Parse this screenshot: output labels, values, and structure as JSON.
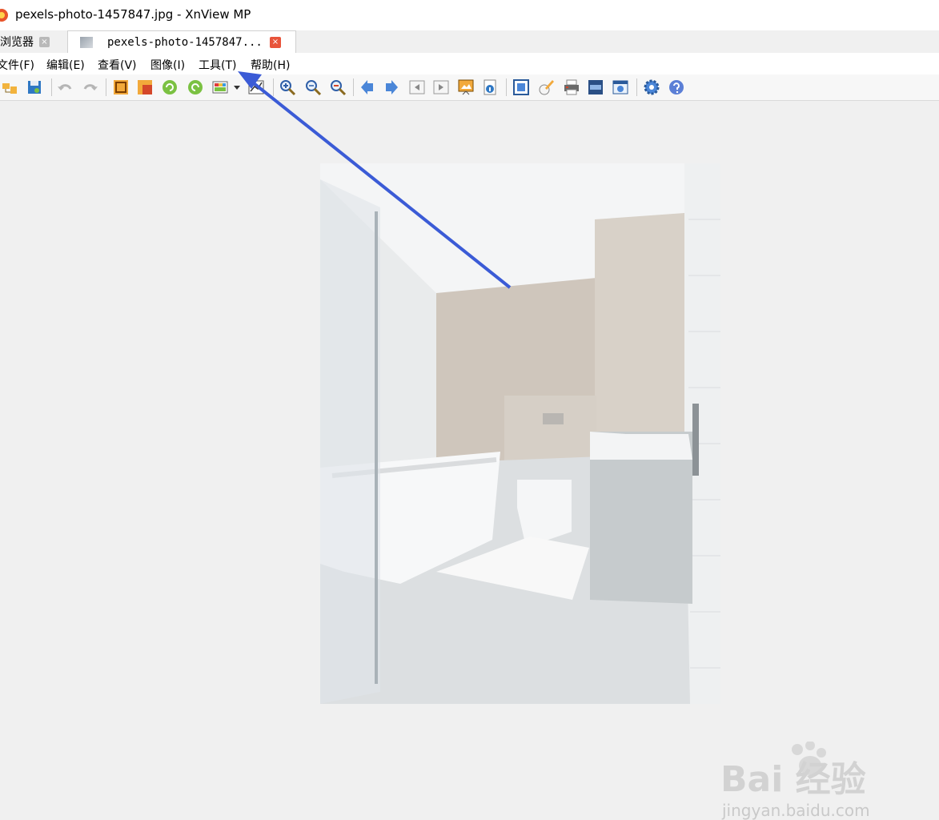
{
  "window": {
    "title": "pexels-photo-1457847.jpg - XnView MP"
  },
  "tabs": [
    {
      "label": "浏览器",
      "close": "×"
    },
    {
      "label": "pexels-photo-1457847...",
      "close": "×"
    }
  ],
  "menu": [
    "文件(F)",
    "编辑(E)",
    "查看(V)",
    "图像(I)",
    "工具(T)",
    "帮助(H)"
  ],
  "toolbar": {
    "icons": [
      "open-folder-icon",
      "save-icon",
      "undo-icon",
      "redo-icon",
      "crop-icon",
      "resize-icon",
      "rotate-left-icon",
      "rotate-right-icon",
      "adjust-colors-icon",
      "dropdown-arrow-icon",
      "levels-icon",
      "zoom-in-icon",
      "zoom-reset-icon",
      "zoom-out-icon",
      "prev-icon",
      "next-icon",
      "first-icon",
      "last-icon",
      "slideshow-icon",
      "info-icon",
      "fullscreen-icon",
      "edit-icon",
      "print-icon",
      "filmstrip-icon",
      "screenshot-icon",
      "settings-icon",
      "help-icon"
    ]
  },
  "watermark": {
    "logo_text": "Bai 经验",
    "url": "jingyan.baidu.com"
  },
  "colors": {
    "arrow": "#3b5bd6",
    "close_active": "#e8543b"
  }
}
